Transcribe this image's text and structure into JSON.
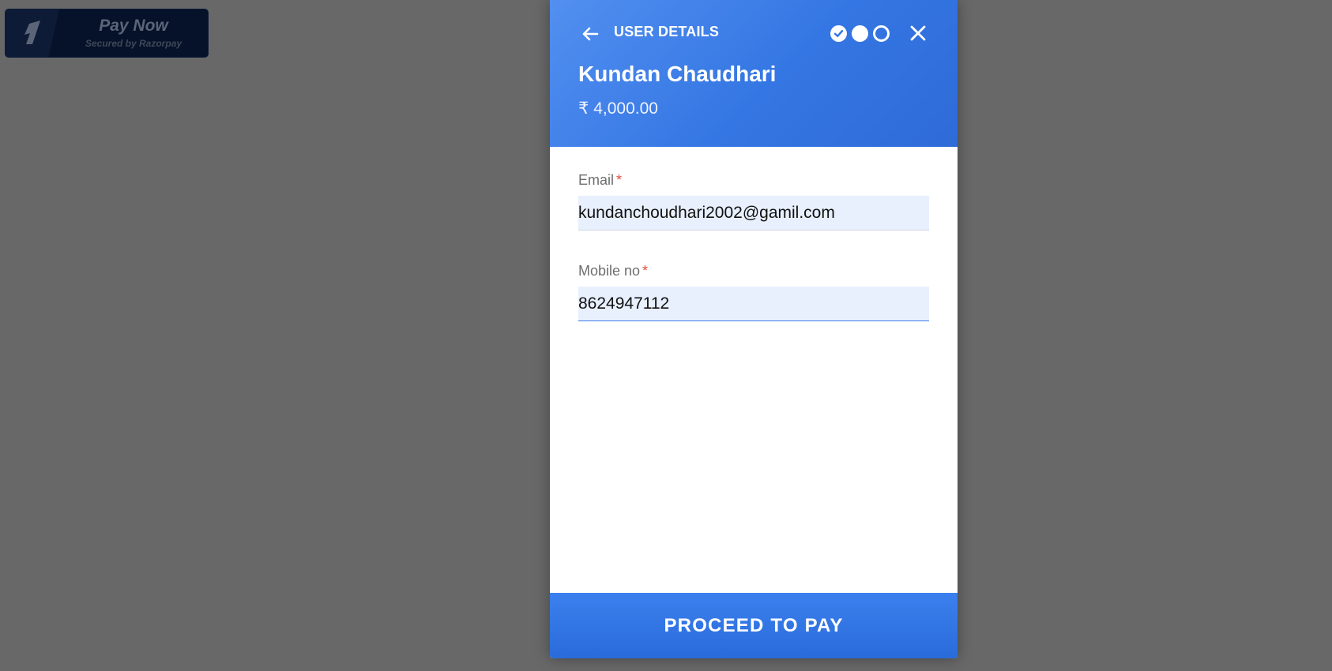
{
  "pay_button": {
    "title": "Pay Now",
    "subtitle": "Secured by Razorpay"
  },
  "checkout": {
    "step_title": "USER DETAILS",
    "steps": [
      "done",
      "current",
      "todo"
    ],
    "merchant_name": "Kundan Chaudhari",
    "amount": "₹ 4,000.00",
    "fields": {
      "email": {
        "label": "Email",
        "required_mark": "*",
        "value": "kundanchoudhari2002@gamil.com"
      },
      "mobile": {
        "label": "Mobile no",
        "required_mark": "*",
        "value": "8624947112"
      }
    },
    "proceed_label": "PROCEED TO PAY"
  },
  "colors": {
    "backdrop": "#686868",
    "header_blue": "#3476e3",
    "button_blue": "#2a6bda",
    "input_bg": "#e8f0fe",
    "required": "#e74c3c"
  },
  "icons": [
    "razorpay-logo-icon",
    "back-arrow-icon",
    "check-icon",
    "close-icon"
  ]
}
